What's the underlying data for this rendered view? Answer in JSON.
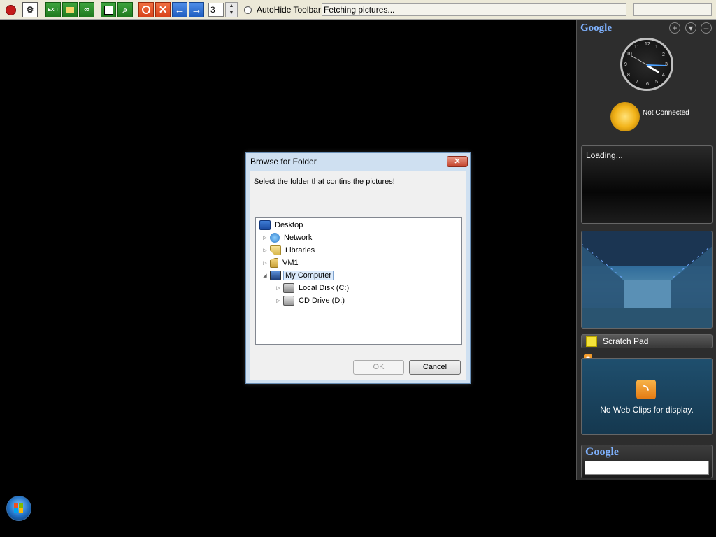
{
  "toolbar": {
    "buttons": [
      {
        "name": "stop-record-button",
        "icon": "red-circle-icon"
      },
      {
        "name": "settings-button",
        "icon": "config-icon"
      },
      {
        "name": "exit-button",
        "icon": "exit-icon",
        "label": "EXIT"
      },
      {
        "name": "open-folder-button",
        "icon": "folder-icon"
      },
      {
        "name": "binoculars-button",
        "icon": "binoculars-icon"
      },
      {
        "name": "save-button",
        "icon": "save-icon"
      },
      {
        "name": "zoom-button",
        "icon": "magnifier-icon"
      },
      {
        "name": "pause-button",
        "icon": "pause-icon"
      },
      {
        "name": "close-button",
        "icon": "close-icon"
      },
      {
        "name": "back-button",
        "icon": "arrow-left-icon"
      },
      {
        "name": "forward-button",
        "icon": "arrow-right-icon"
      }
    ],
    "spinner_value": "3",
    "autohide_label": "AutoHide Toolbar",
    "status_text": "Fetching pictures..."
  },
  "sidebar": {
    "logo": "Google",
    "controls": [
      "+",
      "▾",
      "–"
    ],
    "clock_numbers": [
      "12",
      "1",
      "2",
      "3",
      "4",
      "5",
      "6",
      "7",
      "8",
      "9",
      "10",
      "11"
    ],
    "weather_status": "Not Connected",
    "loading_text": "Loading...",
    "scratch_pad_label": "Scratch Pad",
    "webclips_text": "No Web Clips for display.",
    "search_logo": "Google"
  },
  "dialog": {
    "title": "Browse for Folder",
    "close_glyph": "✕",
    "prompt": "Select the folder that contins the pictures!",
    "tree": [
      {
        "label": "Desktop",
        "expander": ""
      },
      {
        "label": "Network",
        "expander": "▷"
      },
      {
        "label": "Libraries",
        "expander": "▷"
      },
      {
        "label": "VM1",
        "expander": "▷"
      },
      {
        "label": "My Computer",
        "expander": "◢"
      },
      {
        "label": "Local Disk (C:)",
        "expander": "▷"
      },
      {
        "label": "CD Drive (D:)",
        "expander": "▷"
      }
    ],
    "ok_label": "OK",
    "cancel_label": "Cancel"
  },
  "colors": {
    "desktop_background": "#000000",
    "dialog_frame": "#cfe0f1",
    "sidebar_background": "#2d2d2d"
  }
}
